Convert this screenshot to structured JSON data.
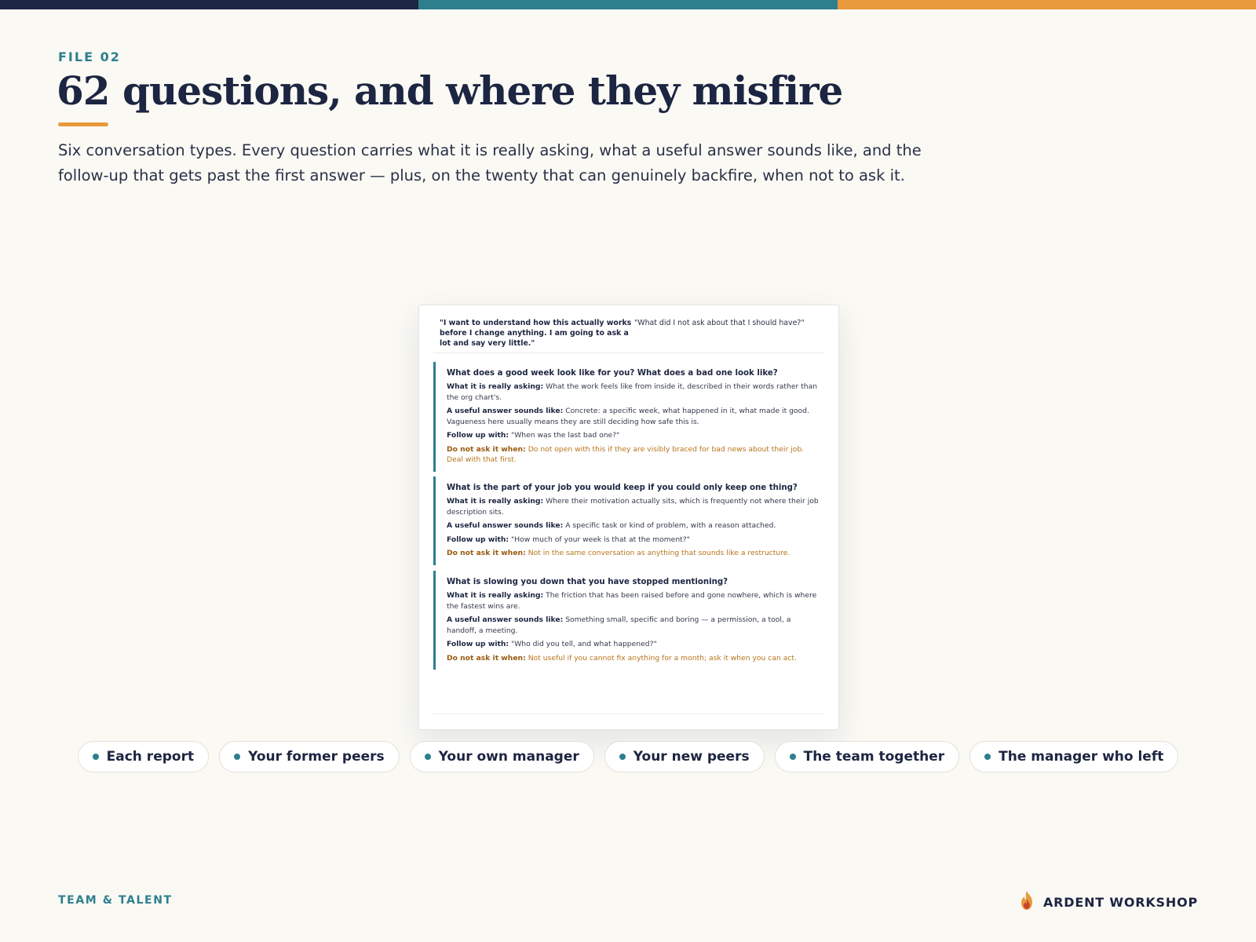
{
  "colors": {
    "navy": "#1c2541",
    "teal": "#2e7f8e",
    "orange": "#e8993b",
    "warning_text": "#b8741c",
    "background": "#faf9f4"
  },
  "header": {
    "eyebrow": "FILE 02",
    "title": "62 questions, and where they misfire",
    "lede": "Six conversation types. Every question carries what it is really asking, what a useful answer sounds like, and the follow-up that gets past the first answer — plus, on the twenty that can genuinely backfire, when not to ask it."
  },
  "preview": {
    "quote_left": "\"I want to understand how this actually works before I change anything. I am going to ask a lot and say very little.\"",
    "quote_right": "\"What did I not ask about that I should have?\"",
    "labels": {
      "asking": "What it is really asking:",
      "answer": "A useful answer sounds like:",
      "follow": "Follow up with:",
      "avoid": "Do not ask it when:"
    },
    "questions": [
      {
        "question": "What does a good week look like for you? What does a bad one look like?",
        "asking": "What the work feels like from inside it, described in their words rather than the org chart's.",
        "answer": "Concrete: a specific week, what happened in it, what made it good. Vagueness here usually means they are still deciding how safe this is.",
        "follow": "\"When was the last bad one?\"",
        "avoid": "Do not open with this if they are visibly braced for bad news about their job. Deal with that first."
      },
      {
        "question": "What is the part of your job you would keep if you could only keep one thing?",
        "asking": "Where their motivation actually sits, which is frequently not where their job description sits.",
        "answer": "A specific task or kind of problem, with a reason attached.",
        "follow": "\"How much of your week is that at the moment?\"",
        "avoid": "Not in the same conversation as anything that sounds like a restructure."
      },
      {
        "question": "What is slowing you down that you have stopped mentioning?",
        "asking": "The friction that has been raised before and gone nowhere, which is where the fastest wins are.",
        "answer": "Something small, specific and boring — a permission, a tool, a handoff, a meeting.",
        "follow": "\"Who did you tell, and what happened?\"",
        "avoid": "Not useful if you cannot fix anything for a month; ask it when you can act."
      }
    ]
  },
  "tabs": [
    {
      "label": "Each report"
    },
    {
      "label": "Your former peers"
    },
    {
      "label": "Your own manager"
    },
    {
      "label": "Your new peers"
    },
    {
      "label": "The team together"
    },
    {
      "label": "The manager who left"
    }
  ],
  "footer": {
    "section": "TEAM & TALENT",
    "brand": "ARDENT WORKSHOP",
    "brand_icon": "flame-icon"
  }
}
